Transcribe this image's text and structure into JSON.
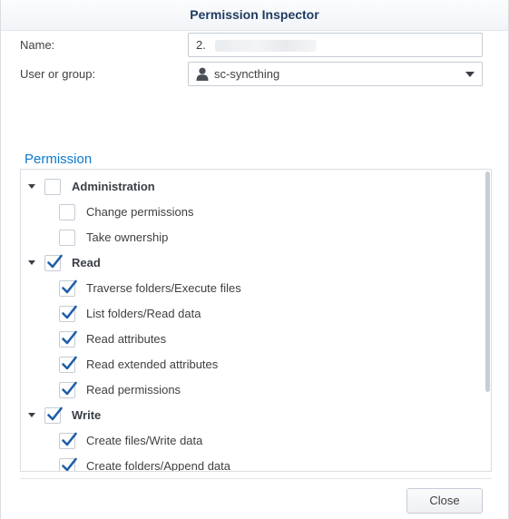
{
  "dialog": {
    "title": "Permission Inspector"
  },
  "form": {
    "name_label": "Name:",
    "name_value": "2.",
    "user_group_label": "User or group:",
    "user_group_value": "sc-syncthing"
  },
  "permission": {
    "section_title": "Permission",
    "groups": [
      {
        "label": "Administration",
        "checked": false,
        "expanded": true,
        "items": [
          {
            "label": "Change permissions",
            "checked": false
          },
          {
            "label": "Take ownership",
            "checked": false
          }
        ]
      },
      {
        "label": "Read",
        "checked": true,
        "expanded": true,
        "items": [
          {
            "label": "Traverse folders/Execute files",
            "checked": true
          },
          {
            "label": "List folders/Read data",
            "checked": true
          },
          {
            "label": "Read attributes",
            "checked": true
          },
          {
            "label": "Read extended attributes",
            "checked": true
          },
          {
            "label": "Read permissions",
            "checked": true
          }
        ]
      },
      {
        "label": "Write",
        "checked": true,
        "expanded": true,
        "items": [
          {
            "label": "Create files/Write data",
            "checked": true
          },
          {
            "label": "Create folders/Append data",
            "checked": true
          }
        ]
      }
    ]
  },
  "footer": {
    "close_label": "Close"
  },
  "colors": {
    "accent": "#0b7ad1",
    "check": "#1f5ea8",
    "title": "#1d3a5f"
  }
}
